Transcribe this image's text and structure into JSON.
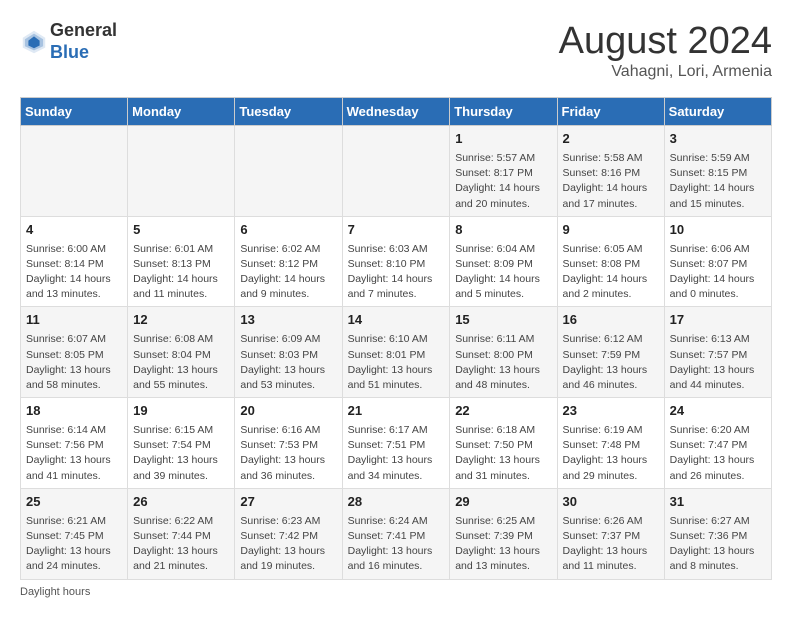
{
  "header": {
    "logo_line1": "General",
    "logo_line2": "Blue",
    "month_year": "August 2024",
    "location": "Vahagni, Lori, Armenia"
  },
  "calendar": {
    "days_of_week": [
      "Sunday",
      "Monday",
      "Tuesday",
      "Wednesday",
      "Thursday",
      "Friday",
      "Saturday"
    ],
    "weeks": [
      [
        {
          "day": "",
          "info": ""
        },
        {
          "day": "",
          "info": ""
        },
        {
          "day": "",
          "info": ""
        },
        {
          "day": "",
          "info": ""
        },
        {
          "day": "1",
          "info": "Sunrise: 5:57 AM\nSunset: 8:17 PM\nDaylight: 14 hours and 20 minutes."
        },
        {
          "day": "2",
          "info": "Sunrise: 5:58 AM\nSunset: 8:16 PM\nDaylight: 14 hours and 17 minutes."
        },
        {
          "day": "3",
          "info": "Sunrise: 5:59 AM\nSunset: 8:15 PM\nDaylight: 14 hours and 15 minutes."
        }
      ],
      [
        {
          "day": "4",
          "info": "Sunrise: 6:00 AM\nSunset: 8:14 PM\nDaylight: 14 hours and 13 minutes."
        },
        {
          "day": "5",
          "info": "Sunrise: 6:01 AM\nSunset: 8:13 PM\nDaylight: 14 hours and 11 minutes."
        },
        {
          "day": "6",
          "info": "Sunrise: 6:02 AM\nSunset: 8:12 PM\nDaylight: 14 hours and 9 minutes."
        },
        {
          "day": "7",
          "info": "Sunrise: 6:03 AM\nSunset: 8:10 PM\nDaylight: 14 hours and 7 minutes."
        },
        {
          "day": "8",
          "info": "Sunrise: 6:04 AM\nSunset: 8:09 PM\nDaylight: 14 hours and 5 minutes."
        },
        {
          "day": "9",
          "info": "Sunrise: 6:05 AM\nSunset: 8:08 PM\nDaylight: 14 hours and 2 minutes."
        },
        {
          "day": "10",
          "info": "Sunrise: 6:06 AM\nSunset: 8:07 PM\nDaylight: 14 hours and 0 minutes."
        }
      ],
      [
        {
          "day": "11",
          "info": "Sunrise: 6:07 AM\nSunset: 8:05 PM\nDaylight: 13 hours and 58 minutes."
        },
        {
          "day": "12",
          "info": "Sunrise: 6:08 AM\nSunset: 8:04 PM\nDaylight: 13 hours and 55 minutes."
        },
        {
          "day": "13",
          "info": "Sunrise: 6:09 AM\nSunset: 8:03 PM\nDaylight: 13 hours and 53 minutes."
        },
        {
          "day": "14",
          "info": "Sunrise: 6:10 AM\nSunset: 8:01 PM\nDaylight: 13 hours and 51 minutes."
        },
        {
          "day": "15",
          "info": "Sunrise: 6:11 AM\nSunset: 8:00 PM\nDaylight: 13 hours and 48 minutes."
        },
        {
          "day": "16",
          "info": "Sunrise: 6:12 AM\nSunset: 7:59 PM\nDaylight: 13 hours and 46 minutes."
        },
        {
          "day": "17",
          "info": "Sunrise: 6:13 AM\nSunset: 7:57 PM\nDaylight: 13 hours and 44 minutes."
        }
      ],
      [
        {
          "day": "18",
          "info": "Sunrise: 6:14 AM\nSunset: 7:56 PM\nDaylight: 13 hours and 41 minutes."
        },
        {
          "day": "19",
          "info": "Sunrise: 6:15 AM\nSunset: 7:54 PM\nDaylight: 13 hours and 39 minutes."
        },
        {
          "day": "20",
          "info": "Sunrise: 6:16 AM\nSunset: 7:53 PM\nDaylight: 13 hours and 36 minutes."
        },
        {
          "day": "21",
          "info": "Sunrise: 6:17 AM\nSunset: 7:51 PM\nDaylight: 13 hours and 34 minutes."
        },
        {
          "day": "22",
          "info": "Sunrise: 6:18 AM\nSunset: 7:50 PM\nDaylight: 13 hours and 31 minutes."
        },
        {
          "day": "23",
          "info": "Sunrise: 6:19 AM\nSunset: 7:48 PM\nDaylight: 13 hours and 29 minutes."
        },
        {
          "day": "24",
          "info": "Sunrise: 6:20 AM\nSunset: 7:47 PM\nDaylight: 13 hours and 26 minutes."
        }
      ],
      [
        {
          "day": "25",
          "info": "Sunrise: 6:21 AM\nSunset: 7:45 PM\nDaylight: 13 hours and 24 minutes."
        },
        {
          "day": "26",
          "info": "Sunrise: 6:22 AM\nSunset: 7:44 PM\nDaylight: 13 hours and 21 minutes."
        },
        {
          "day": "27",
          "info": "Sunrise: 6:23 AM\nSunset: 7:42 PM\nDaylight: 13 hours and 19 minutes."
        },
        {
          "day": "28",
          "info": "Sunrise: 6:24 AM\nSunset: 7:41 PM\nDaylight: 13 hours and 16 minutes."
        },
        {
          "day": "29",
          "info": "Sunrise: 6:25 AM\nSunset: 7:39 PM\nDaylight: 13 hours and 13 minutes."
        },
        {
          "day": "30",
          "info": "Sunrise: 6:26 AM\nSunset: 7:37 PM\nDaylight: 13 hours and 11 minutes."
        },
        {
          "day": "31",
          "info": "Sunrise: 6:27 AM\nSunset: 7:36 PM\nDaylight: 13 hours and 8 minutes."
        }
      ]
    ]
  },
  "footer": {
    "note": "Daylight hours"
  }
}
